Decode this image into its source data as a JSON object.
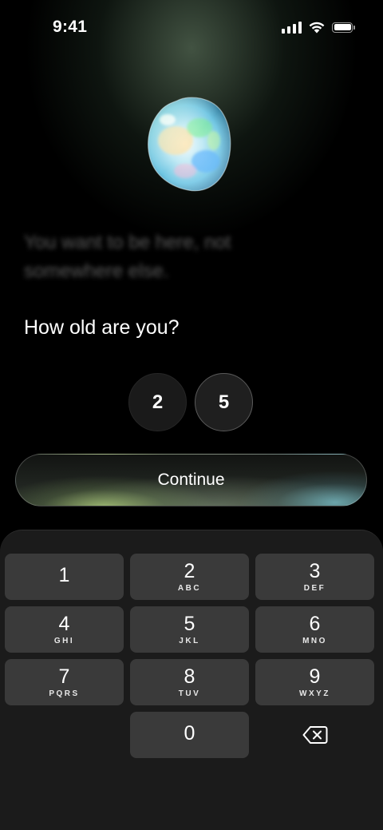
{
  "status_bar": {
    "time": "9:41"
  },
  "intro": {
    "blurred_text": "You want to be here, not somewhere else."
  },
  "question": "How old are you?",
  "age_digits": [
    "2",
    "5"
  ],
  "continue_label": "Continue",
  "keypad": {
    "keys": [
      {
        "num": "1",
        "letters": ""
      },
      {
        "num": "2",
        "letters": "ABC"
      },
      {
        "num": "3",
        "letters": "DEF"
      },
      {
        "num": "4",
        "letters": "GHI"
      },
      {
        "num": "5",
        "letters": "JKL"
      },
      {
        "num": "6",
        "letters": "MNO"
      },
      {
        "num": "7",
        "letters": "PQRS"
      },
      {
        "num": "8",
        "letters": "TUV"
      },
      {
        "num": "9",
        "letters": "WXYZ"
      },
      {
        "num": "0",
        "letters": ""
      }
    ]
  },
  "icons": {
    "gem": "opal-gem-icon",
    "delete": "backspace-icon",
    "signal": "cellular-signal-icon",
    "wifi": "wifi-icon",
    "battery": "battery-icon"
  }
}
